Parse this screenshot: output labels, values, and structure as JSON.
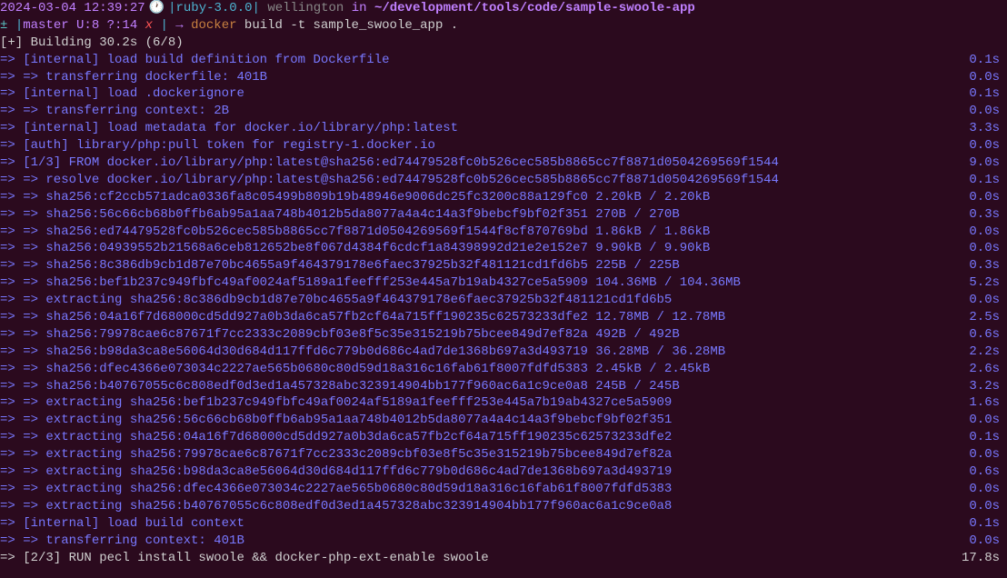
{
  "prompt1": {
    "datetime": "2024-03-04 12:39:27",
    "clock": "🕐",
    "ruby": "ruby-3.0.0",
    "user": "wellington",
    "in": "in",
    "path": "~/development/tools/code/sample-swoole-app"
  },
  "prompt2": {
    "plus": "±",
    "master": "master U:8 ?:14",
    "x": "x",
    "arrow": "→",
    "cmd": "docker",
    "args": "build -t sample_swoole_app ."
  },
  "building": "[+] Building 30.2s (6/8)",
  "steps": [
    {
      "text": "=> [internal] load build definition from Dockerfile",
      "time": "0.1s"
    },
    {
      "text": "=> => transferring dockerfile: 401B",
      "time": "0.0s"
    },
    {
      "text": "=> [internal] load .dockerignore",
      "time": "0.1s"
    },
    {
      "text": "=> => transferring context: 2B",
      "time": "0.0s"
    },
    {
      "text": "=> [internal] load metadata for docker.io/library/php:latest",
      "time": "3.3s"
    },
    {
      "text": "=> [auth] library/php:pull token for registry-1.docker.io",
      "time": "0.0s"
    },
    {
      "text": "=> [1/3] FROM docker.io/library/php:latest@sha256:ed74479528fc0b526cec585b8865cc7f8871d0504269569f1544",
      "time": "9.0s"
    },
    {
      "text": "=> => resolve docker.io/library/php:latest@sha256:ed74479528fc0b526cec585b8865cc7f8871d0504269569f1544",
      "time": "0.1s"
    },
    {
      "text": "=> => sha256:cf2ccb571adca0336fa8c05499b809b19b48946e9006dc25fc3200c88a129fc0 2.20kB / 2.20kB",
      "time": "0.0s"
    },
    {
      "text": "=> => sha256:56c66cb68b0ffb6ab95a1aa748b4012b5da8077a4a4c14a3f9bebcf9bf02f351 270B / 270B",
      "time": "0.3s"
    },
    {
      "text": "=> => sha256:ed74479528fc0b526cec585b8865cc7f8871d0504269569f1544f8cf870769bd 1.86kB / 1.86kB",
      "time": "0.0s"
    },
    {
      "text": "=> => sha256:04939552b21568a6ceb812652be8f067d4384f6cdcf1a84398992d21e2e152e7 9.90kB / 9.90kB",
      "time": "0.0s"
    },
    {
      "text": "=> => sha256:8c386db9cb1d87e70bc4655a9f464379178e6faec37925b32f481121cd1fd6b5 225B / 225B",
      "time": "0.3s"
    },
    {
      "text": "=> => sha256:bef1b237c949fbfc49af0024af5189a1feefff253e445a7b19ab4327ce5a5909 104.36MB / 104.36MB",
      "time": "5.2s"
    },
    {
      "text": "=> => extracting sha256:8c386db9cb1d87e70bc4655a9f464379178e6faec37925b32f481121cd1fd6b5",
      "time": "0.0s"
    },
    {
      "text": "=> => sha256:04a16f7d68000cd5dd927a0b3da6ca57fb2cf64a715ff190235c62573233dfe2 12.78MB / 12.78MB",
      "time": "2.5s"
    },
    {
      "text": "=> => sha256:79978cae6c87671f7cc2333c2089cbf03e8f5c35e315219b75bcee849d7ef82a 492B / 492B",
      "time": "0.6s"
    },
    {
      "text": "=> => sha256:b98da3ca8e56064d30d684d117ffd6c779b0d686c4ad7de1368b697a3d493719 36.28MB / 36.28MB",
      "time": "2.2s"
    },
    {
      "text": "=> => sha256:dfec4366e073034c2227ae565b0680c80d59d18a316c16fab61f8007fdfd5383 2.45kB / 2.45kB",
      "time": "2.6s"
    },
    {
      "text": "=> => sha256:b40767055c6c808edf0d3ed1a457328abc323914904bb177f960ac6a1c9ce0a8 245B / 245B",
      "time": "3.2s"
    },
    {
      "text": "=> => extracting sha256:bef1b237c949fbfc49af0024af5189a1feefff253e445a7b19ab4327ce5a5909",
      "time": "1.6s"
    },
    {
      "text": "=> => extracting sha256:56c66cb68b0ffb6ab95a1aa748b4012b5da8077a4a4c14a3f9bebcf9bf02f351",
      "time": "0.0s"
    },
    {
      "text": "=> => extracting sha256:04a16f7d68000cd5dd927a0b3da6ca57fb2cf64a715ff190235c62573233dfe2",
      "time": "0.1s"
    },
    {
      "text": "=> => extracting sha256:79978cae6c87671f7cc2333c2089cbf03e8f5c35e315219b75bcee849d7ef82a",
      "time": "0.0s"
    },
    {
      "text": "=> => extracting sha256:b98da3ca8e56064d30d684d117ffd6c779b0d686c4ad7de1368b697a3d493719",
      "time": "0.6s"
    },
    {
      "text": "=> => extracting sha256:dfec4366e073034c2227ae565b0680c80d59d18a316c16fab61f8007fdfd5383",
      "time": "0.0s"
    },
    {
      "text": "=> => extracting sha256:b40767055c6c808edf0d3ed1a457328abc323914904bb177f960ac6a1c9ce0a8",
      "time": "0.0s"
    },
    {
      "text": "=> [internal] load build context",
      "time": "0.1s"
    },
    {
      "text": "=> => transferring context: 401B",
      "time": "0.0s"
    }
  ],
  "current": {
    "text": "=> [2/3] RUN pecl install swoole     && docker-php-ext-enable swoole",
    "time": "17.8s"
  }
}
